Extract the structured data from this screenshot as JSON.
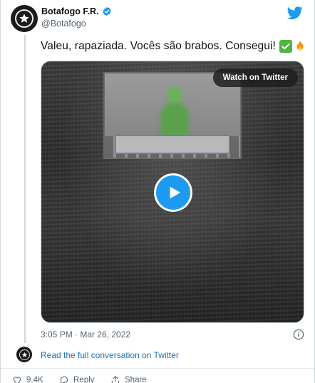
{
  "account": {
    "display_name": "Botafogo F.R.",
    "handle": "@Botafogo",
    "verified": true
  },
  "tweet": {
    "text": "Valeu, rapaziada. Vocês são brabos. Consegui!",
    "emojis": [
      "white-heavy-check-mark",
      "fire"
    ],
    "timestamp": "3:05 PM · Mar 26, 2022"
  },
  "media": {
    "type": "video",
    "watch_label": "Watch on Twitter"
  },
  "conversation": {
    "link_text": "Read the full conversation on Twitter"
  },
  "actions": {
    "likes": "9.4K",
    "reply_label": "Reply",
    "share_label": "Share"
  },
  "icons": {
    "brand": "twitter-bird-icon",
    "verified": "verified-badge-icon",
    "info": "info-icon",
    "play": "play-icon",
    "like": "heart-icon",
    "reply": "reply-icon",
    "share": "share-icon"
  },
  "colors": {
    "twitter_blue": "#1d9bf0",
    "link": "#1d70b8",
    "text_primary": "#0f1419",
    "text_secondary": "#536471"
  }
}
